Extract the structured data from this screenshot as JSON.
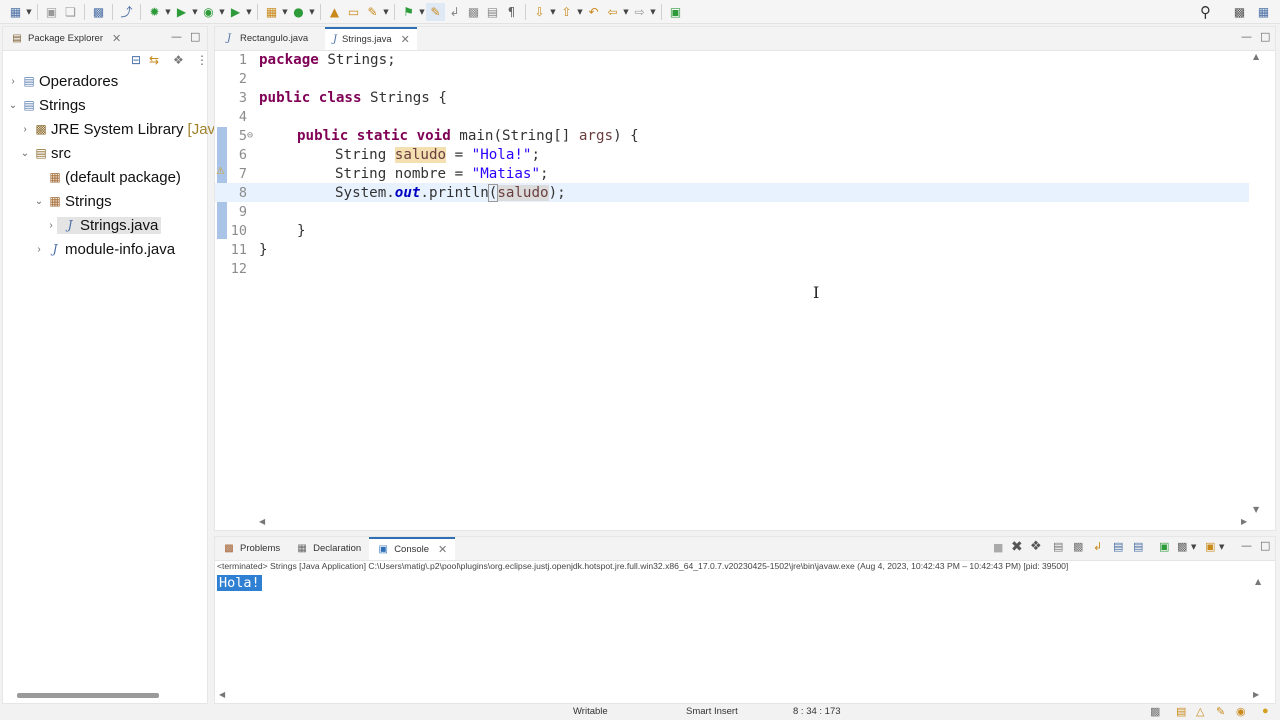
{
  "toolbar": {
    "icons": [
      "new-icon",
      "save-icon",
      "save-all-icon",
      "terminal-icon",
      "skip-breakpoints-icon",
      "debug-icon",
      "run-icon",
      "coverage-icon",
      "external-tools-icon",
      "new-java-package-icon",
      "new-java-class-icon",
      "open-type-icon",
      "open-task-icon",
      "search-icon",
      "annotation-icon",
      "mark-occurrences-icon",
      "word-wrap-icon",
      "block-selection-icon",
      "show-whitespace-icon",
      "next-annotation-icon",
      "previous-annotation-icon",
      "last-edit-icon",
      "back-icon",
      "forward-icon",
      "pin-editor-icon"
    ]
  },
  "package_explorer": {
    "tab_label": "Package Explorer",
    "tree": [
      {
        "label": "Operadores",
        "icon": "project-icon",
        "expanded": false,
        "depth": 0
      },
      {
        "label": "Strings",
        "icon": "project-icon",
        "expanded": true,
        "depth": 0
      },
      {
        "label": "JRE System Library",
        "suffix": "[Jav",
        "icon": "library-icon",
        "expanded": false,
        "depth": 1
      },
      {
        "label": "src",
        "icon": "source-folder-icon",
        "expanded": true,
        "depth": 1
      },
      {
        "label": "(default package)",
        "icon": "package-icon",
        "expanded": false,
        "depth": 2
      },
      {
        "label": "Strings",
        "icon": "package-icon",
        "expanded": true,
        "depth": 2
      },
      {
        "label": "Strings.java",
        "icon": "java-file-icon",
        "expanded": false,
        "depth": 3,
        "selected": true
      },
      {
        "label": "module-info.java",
        "icon": "java-file-icon",
        "expanded": false,
        "depth": 2
      }
    ]
  },
  "editor": {
    "tabs": [
      {
        "label": "Rectangulo.java",
        "active": false
      },
      {
        "label": "Strings.java",
        "active": true
      }
    ],
    "line_numbers": [
      "1",
      "2",
      "3",
      "4",
      "5",
      "6",
      "7",
      "8",
      "9",
      "10",
      "11",
      "12"
    ],
    "code": {
      "l1_kw": "package",
      "l1_rest": " Strings;",
      "l3_kw1": "public",
      "l3_kw2": "class",
      "l3_rest": " Strings {",
      "l5_kw1": "public",
      "l5_kw2": "static",
      "l5_kw3": "void",
      "l5_a": " main(String[] ",
      "l5_args": "args",
      "l5_b": ") {",
      "l6_a": "String ",
      "l6_var": "saludo",
      "l6_b": " = ",
      "l6_str": "\"Hola!\"",
      "l6_c": ";",
      "l7_a": "String nombre = ",
      "l7_str": "\"Matias\"",
      "l7_c": ";",
      "l8_a": "System.",
      "l8_fld": "out",
      "l8_b": ".println",
      "l8_p1": "(",
      "l8_var": "saludo",
      "l8_p2": ")",
      "l8_c": ";",
      "l10": "}",
      "l11": "}"
    },
    "fold_marker": "⊖"
  },
  "console": {
    "tabs": [
      {
        "label": "Problems",
        "active": false
      },
      {
        "label": "Declaration",
        "active": false
      },
      {
        "label": "Console",
        "active": true
      }
    ],
    "terminated_line": "<terminated> Strings [Java Application] C:\\Users\\matig\\.p2\\pool\\plugins\\org.eclipse.justj.openjdk.hotspot.jre.full.win32.x86_64_17.0.7.v20230425-1502\\jre\\bin\\javaw.exe  (Aug 4, 2023, 10:42:43 PM – 10:42:43 PM) [pid: 39500]",
    "output": "Hola!"
  },
  "status_bar": {
    "writable": "Writable",
    "insert_mode": "Smart Insert",
    "position": "8 : 34 : 173"
  },
  "colors": {
    "keyword": "#7f0055",
    "string": "#2a00ff",
    "field": "#0000c0",
    "selection_blue": "#2f6fb5",
    "occurrence_highlight": "#f3dfb0"
  }
}
